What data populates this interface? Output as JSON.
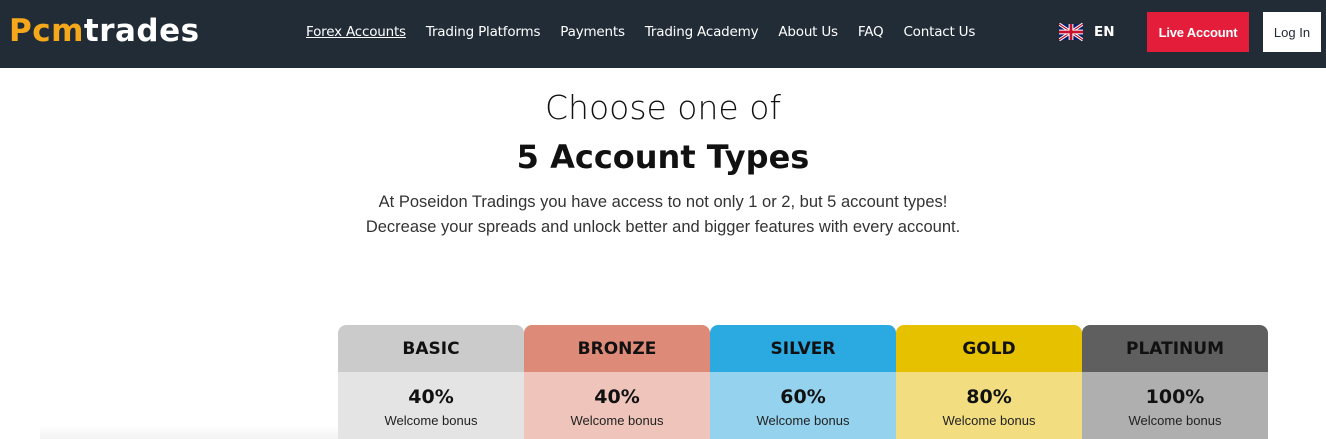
{
  "header": {
    "logo": {
      "part1": "Pcm",
      "part2": "trades"
    },
    "nav": [
      {
        "label": "Forex Accounts",
        "active": true
      },
      {
        "label": "Trading Platforms",
        "active": false
      },
      {
        "label": "Payments",
        "active": false
      },
      {
        "label": "Trading Academy",
        "active": false
      },
      {
        "label": "About Us",
        "active": false
      },
      {
        "label": "FAQ",
        "active": false
      },
      {
        "label": "Contact Us",
        "active": false
      }
    ],
    "language": {
      "code": "EN",
      "flag_icon": "uk-flag-icon"
    },
    "live_account_label": "Live Account",
    "login_label": "Log In",
    "colors": {
      "background": "#222c36",
      "logo_accent": "#f5a81c",
      "live_button": "#e31d3a"
    }
  },
  "hero": {
    "title_line1": "Choose one of",
    "title_line2": "5 Account Types",
    "description_line1": "At Poseidon Tradings you have access to not only 1 or 2, but 5 account types!",
    "description_line2": "Decrease your spreads and unlock better and bigger features with every account."
  },
  "accounts": [
    {
      "name": "BASIC",
      "bonus_value": "40%",
      "bonus_label": "Welcome bonus",
      "head_color": "#cbcbcb",
      "body_color": "#e4e4e4"
    },
    {
      "name": "BRONZE",
      "bonus_value": "40%",
      "bonus_label": "Welcome bonus",
      "head_color": "#de8a78",
      "body_color": "#eec4bb"
    },
    {
      "name": "SILVER",
      "bonus_value": "60%",
      "bonus_label": "Welcome bonus",
      "head_color": "#2ba9e1",
      "body_color": "#94d2ee"
    },
    {
      "name": "GOLD",
      "bonus_value": "80%",
      "bonus_label": "Welcome bonus",
      "head_color": "#e5c100",
      "body_color": "#f2de80"
    },
    {
      "name": "PLATINUM",
      "bonus_value": "100%",
      "bonus_label": "Welcome bonus",
      "head_color": "#5f5f5f",
      "body_color": "#afafaf"
    }
  ]
}
